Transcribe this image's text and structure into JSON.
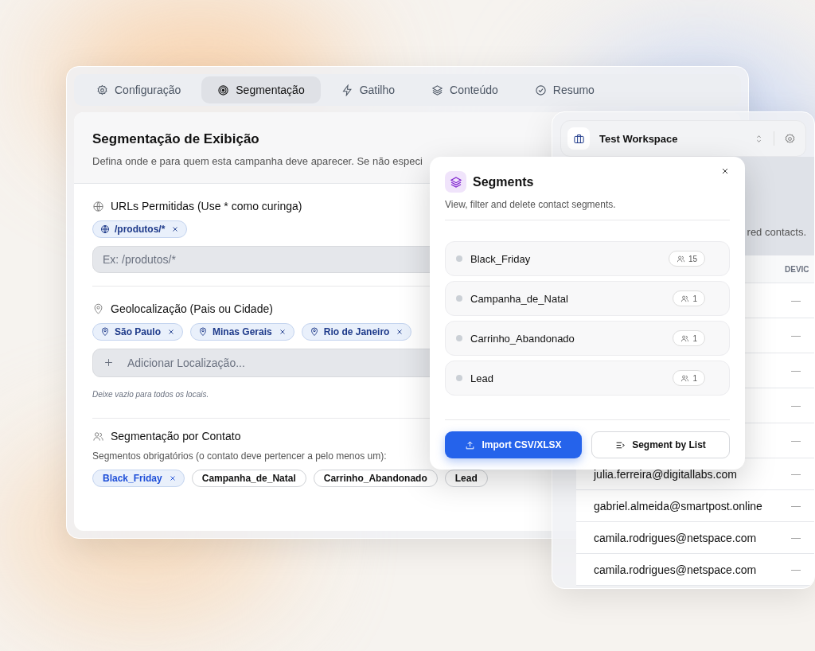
{
  "tabs": [
    {
      "label": "Configuração",
      "selected": false
    },
    {
      "label": "Segmentação",
      "selected": true
    },
    {
      "label": "Gatilho",
      "selected": false
    },
    {
      "label": "Conteúdo",
      "selected": false
    },
    {
      "label": "Resumo",
      "selected": false
    }
  ],
  "section": {
    "title": "Segmentação de Exibição",
    "description": "Defina onde e para quem esta campanha deve aparecer. Se não especi"
  },
  "urls": {
    "label": "URLs Permitidas (Use * como curinga)",
    "tags": [
      "/produtos/*"
    ],
    "placeholder": "Ex: /produtos/*"
  },
  "geo": {
    "label": "Geolocalização (Pais ou Cidade)",
    "tags": [
      "São Paulo",
      "Minas Gerais",
      "Rio de Janeiro"
    ],
    "placeholder": "Adicionar Localização...",
    "hint": "Deixe vazio para todos os locais."
  },
  "contact": {
    "label": "Segmentação por Contato",
    "description": "Segmentos obrigatórios (o contato deve pertencer a pelo menos um):",
    "segments": [
      {
        "label": "Black_Friday",
        "selected": true
      },
      {
        "label": "Campanha_de_Natal",
        "selected": false
      },
      {
        "label": "Carrinho_Abandonado",
        "selected": false
      },
      {
        "label": "Lead",
        "selected": false
      }
    ]
  },
  "workspace": {
    "name": "Test Workspace",
    "subtitle": "red contacts.",
    "column": "DEVIC",
    "rows": [
      {
        "device": "—"
      },
      {
        "device": "—"
      },
      {
        "device": "—"
      },
      {
        "device": "—"
      },
      {
        "device": "—"
      },
      {
        "email": "julia.ferreira@digitallabs.com",
        "device": "—"
      },
      {
        "email": "gabriel.almeida@smartpost.online",
        "device": "—"
      },
      {
        "email": "camila.rodrigues@netspace.com",
        "device": "—"
      },
      {
        "email": "camila.rodrigues@netspace.com",
        "device": "—"
      }
    ]
  },
  "modal": {
    "title": "Segments",
    "subtitle": "View, filter and delete contact segments.",
    "segments": [
      {
        "name": "Black_Friday",
        "count": "15"
      },
      {
        "name": "Campanha_de_Natal",
        "count": "1"
      },
      {
        "name": "Carrinho_Abandonado",
        "count": "1"
      },
      {
        "name": "Lead",
        "count": "1"
      }
    ],
    "buttons": [
      {
        "label": "Import CSV/XLSX",
        "kind": "primary"
      },
      {
        "label": "Segment by List",
        "kind": "secondary"
      }
    ]
  }
}
